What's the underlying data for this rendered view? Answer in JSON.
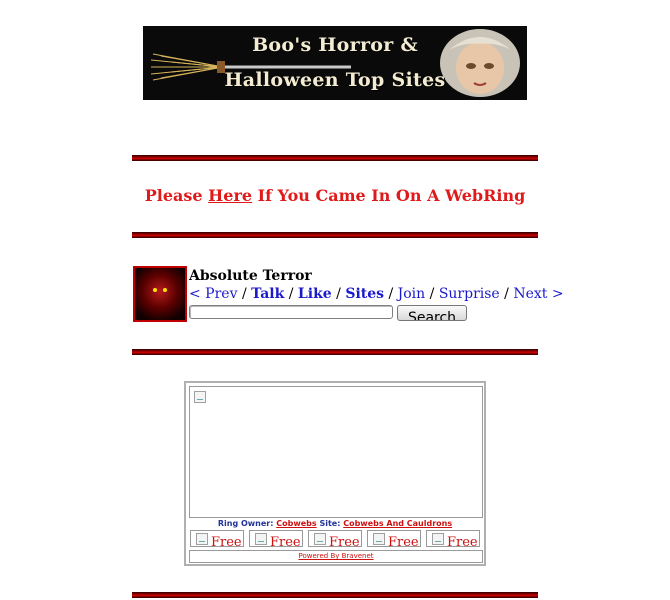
{
  "banner": {
    "line1": "Boo's Horror &",
    "line2": "Halloween Top Sites"
  },
  "webring_notice": {
    "prefix": "Please ",
    "link": "Here",
    "suffix": " If You Came In On A WebRing"
  },
  "ring": {
    "title": "Absolute Terror",
    "nav": {
      "prev": "< Prev",
      "talk": "Talk",
      "like": "Like",
      "sites": "Sites",
      "join": "Join",
      "surprise": "Surprise",
      "next": "Next >",
      "separator": "/"
    },
    "search_button": "Search",
    "search_value": ""
  },
  "bravenet": {
    "ring_owner_label": "Ring Owner:",
    "ring_owner": "Cobwebs",
    "site_label": "Site:",
    "site": "Cobwebs And Cauldrons",
    "free_items": [
      "Free",
      "Free",
      "Free",
      "Free",
      "Free"
    ],
    "powered_by": "Powered By Bravenet"
  },
  "colors": {
    "accent_red": "#e01a1a",
    "link_blue": "#1a1acc",
    "divider_red": "#c00000"
  }
}
